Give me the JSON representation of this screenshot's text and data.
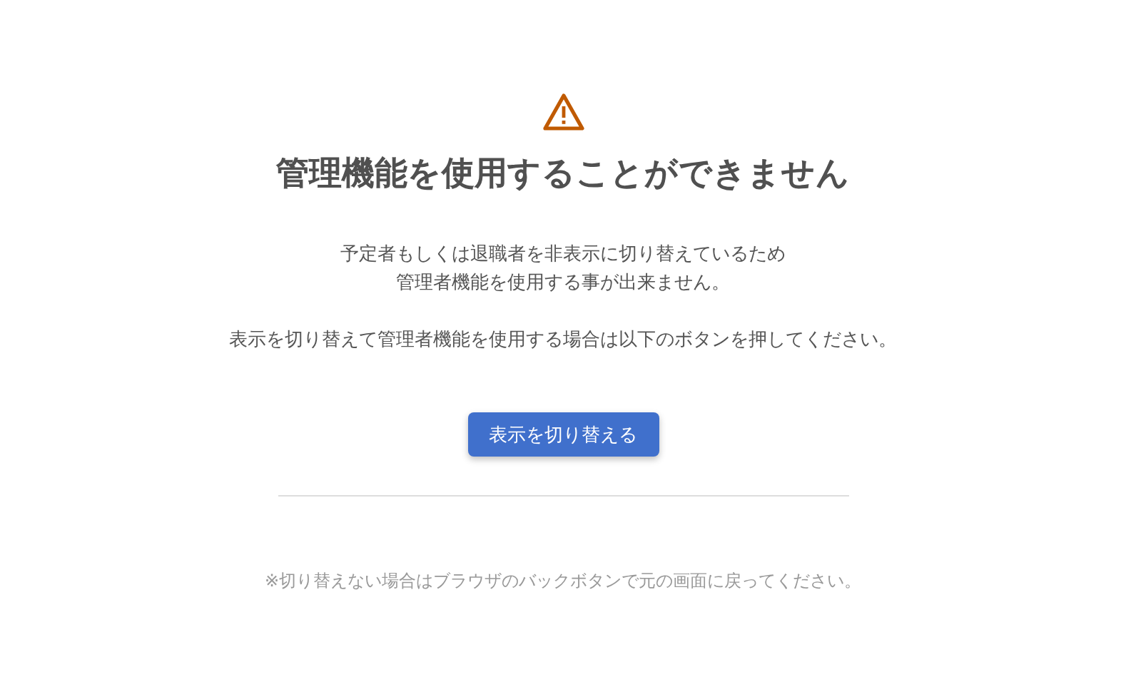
{
  "title": "管理機能を使用することができません",
  "message": "予定者もしくは退職者を非表示に切り替えているため管理者機能を使用する事が出来ません。",
  "instruction": "表示を切り替えて管理者機能を使用する場合は以下のボタンを押してください。",
  "button": "表示を切り替える",
  "note": "※切り替えない場合はブラウザのバックボタンで元の画面に戻ってください。"
}
